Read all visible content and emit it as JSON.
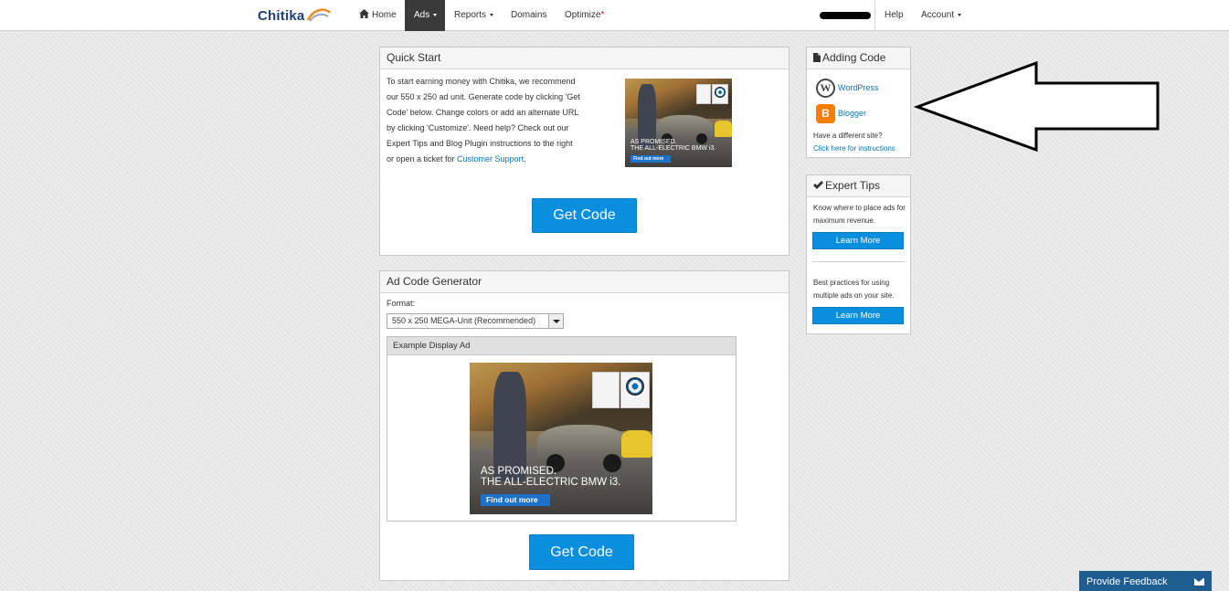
{
  "brand": {
    "logo_text": "Chitika"
  },
  "nav": {
    "home": "Home",
    "ads": "Ads",
    "reports": "Reports",
    "domains": "Domains",
    "optimize": "Optimize",
    "optimize_marker": "*",
    "help": "Help",
    "account": "Account"
  },
  "quick_start": {
    "title": "Quick Start",
    "text": "To start earning money with Chitika, we recommend our 550 x 250 ad unit. Generate code by clicking 'Get Code' below. Change colors or add an alternate URL by clicking 'Customize'. Need help? Check out our Expert Tips and Blog Plugin instructions to the right or open a ticket for ",
    "support_link": "Customer Support",
    "text_end": ".",
    "button": "Get Code"
  },
  "ad": {
    "headline_1": "AS PROMISED.",
    "headline_2": "THE ALL-ELECTRIC BMW i3.",
    "cta": "Find out more"
  },
  "generator": {
    "title": "Ad Code Generator",
    "format_label": "Format:",
    "format_value": "550 x 250 MEGA-Unit (Recommended)",
    "example_title": "Example Display Ad",
    "button": "Get Code"
  },
  "adding_code": {
    "title": "Adding Code",
    "wordpress": "WordPress",
    "blogger": "Blogger",
    "different_site": "Have a different site?",
    "instructions_link": "Click here for instructions"
  },
  "expert_tips": {
    "title": "Expert Tips",
    "tip1": "Know where to place ads for maximum revenue.",
    "tip1_button": "Learn More",
    "tip2": "Best practices for using multiple ads on your site.",
    "tip2_button": "Learn More"
  },
  "feedback": {
    "label": "Provide Feedback"
  }
}
